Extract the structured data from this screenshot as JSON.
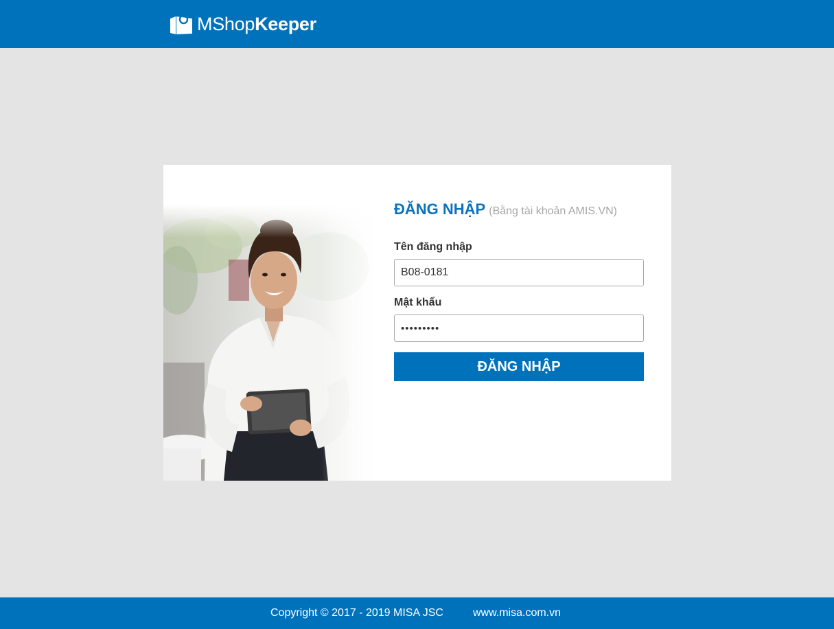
{
  "header": {
    "logo_light": "MShop",
    "logo_bold": "Keeper",
    "logo_icon": "shopping-bag-icon"
  },
  "login": {
    "title": "ĐĂNG NHẬP",
    "subtitle": "(Bằng tài khoản AMIS.VN)",
    "username_label": "Tên đăng nhập",
    "username_value": "B08-0181",
    "password_label": "Mật khẩu",
    "password_value": "•••••••••",
    "submit_label": "ĐĂNG NHẬP"
  },
  "footer": {
    "copyright": "Copyright © 2017 - 2019 MISA JSC",
    "website": "www.misa.com.vn"
  },
  "colors": {
    "brand_blue": "#0072bc",
    "page_background": "#e4e4e4",
    "title_blue": "#0a73bb",
    "subtitle_gray": "#a6a6a6"
  },
  "image": {
    "photo_subject": "woman-with-tablet-photo"
  }
}
